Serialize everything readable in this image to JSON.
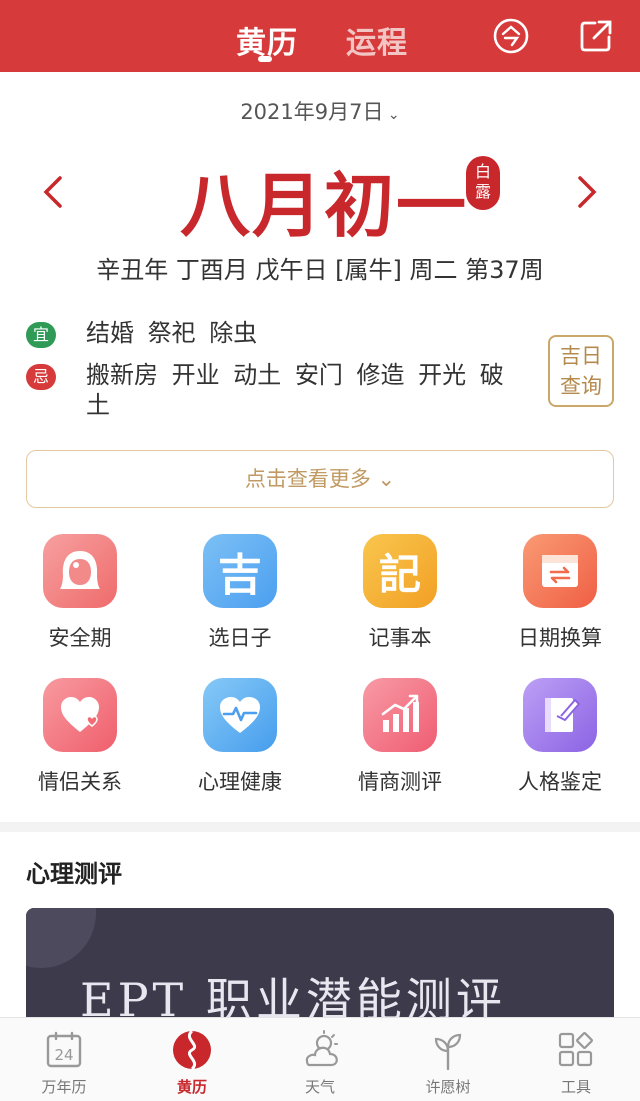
{
  "header": {
    "tabs": [
      {
        "label": "黄历",
        "active": true
      },
      {
        "label": "运程",
        "active": false
      }
    ],
    "today_icon": "today-ling-icon",
    "share_icon": "share-external-icon",
    "color": "#d73a3a"
  },
  "date_selector": "2021年9月7日",
  "lunar_date": "八月初一",
  "solar_term": "白露",
  "ganzhi_line": "辛丑年 丁酉月 戊午日 [属牛] 周二 第37周",
  "yi": {
    "badge": "宜",
    "items": "结婚 祭祀 除虫"
  },
  "ji": {
    "badge": "忌",
    "items": "搬新房 开业 动土 安门 修造 开光 破土"
  },
  "jiri_button": "吉日查询",
  "more_button": "点击查看更多",
  "tools": [
    {
      "label": "安全期",
      "icon": "woman-face-icon",
      "color": "#f07474"
    },
    {
      "label": "选日子",
      "icon": "ji-character-icon",
      "color": "#57a9f0"
    },
    {
      "label": "记事本",
      "icon": "ji-record-character-icon",
      "color": "#f5a623"
    },
    {
      "label": "日期换算",
      "icon": "calendar-convert-icon",
      "color": "#f36b4e"
    },
    {
      "label": "情侣关系",
      "icon": "heart-icon",
      "color": "#f26a73"
    },
    {
      "label": "心理健康",
      "icon": "heart-pulse-icon",
      "color": "#4fa8ee"
    },
    {
      "label": "情商测评",
      "icon": "bar-trend-icon",
      "color": "#f2687a"
    },
    {
      "label": "人格鉴定",
      "icon": "book-pen-icon",
      "color": "#9b74e8"
    }
  ],
  "section": {
    "title": "心理测评",
    "banner_text": "EPT 职业潜能测评"
  },
  "bottom_nav": [
    {
      "label": "万年历",
      "icon": "calendar-24-icon",
      "active": false
    },
    {
      "label": "黄历",
      "icon": "huangli-logo-icon",
      "active": true
    },
    {
      "label": "天气",
      "icon": "weather-cloud-sun-icon",
      "active": false
    },
    {
      "label": "许愿树",
      "icon": "wish-tree-icon",
      "active": false
    },
    {
      "label": "工具",
      "icon": "tools-grid-icon",
      "active": false
    }
  ]
}
